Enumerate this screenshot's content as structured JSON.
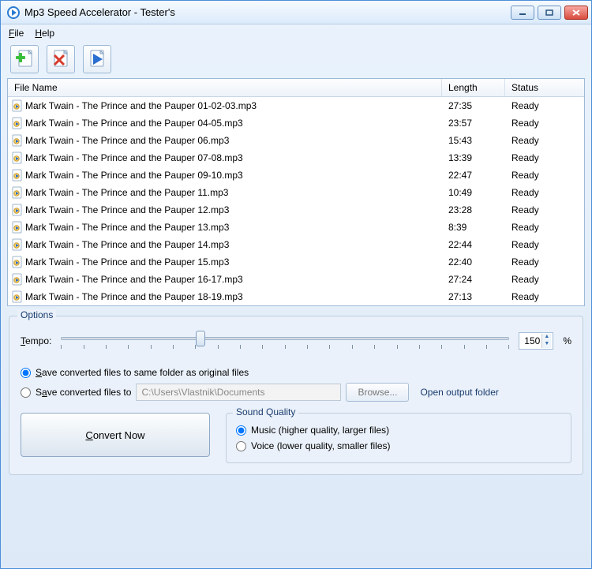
{
  "window": {
    "title": "Mp3 Speed Accelerator - Tester's"
  },
  "menu": {
    "file": "File",
    "help": "Help"
  },
  "columns": {
    "name": "File Name",
    "length": "Length",
    "status": "Status"
  },
  "files": [
    {
      "name": "Mark Twain - The Prince and the Pauper 01-02-03.mp3",
      "length": "27:35",
      "status": "Ready"
    },
    {
      "name": "Mark Twain - The Prince and the Pauper 04-05.mp3",
      "length": "23:57",
      "status": "Ready"
    },
    {
      "name": "Mark Twain - The Prince and the Pauper 06.mp3",
      "length": "15:43",
      "status": "Ready"
    },
    {
      "name": "Mark Twain - The Prince and the Pauper 07-08.mp3",
      "length": "13:39",
      "status": "Ready"
    },
    {
      "name": "Mark Twain - The Prince and the Pauper 09-10.mp3",
      "length": "22:47",
      "status": "Ready"
    },
    {
      "name": "Mark Twain - The Prince and the Pauper 11.mp3",
      "length": "10:49",
      "status": "Ready"
    },
    {
      "name": "Mark Twain - The Prince and the Pauper 12.mp3",
      "length": "23:28",
      "status": "Ready"
    },
    {
      "name": "Mark Twain - The Prince and the Pauper 13.mp3",
      "length": "8:39",
      "status": "Ready"
    },
    {
      "name": "Mark Twain - The Prince and the Pauper 14.mp3",
      "length": "22:44",
      "status": "Ready"
    },
    {
      "name": "Mark Twain - The Prince and the Pauper 15.mp3",
      "length": "22:40",
      "status": "Ready"
    },
    {
      "name": "Mark Twain - The Prince and the Pauper 16-17.mp3",
      "length": "27:24",
      "status": "Ready"
    },
    {
      "name": "Mark Twain - The Prince and the Pauper 18-19.mp3",
      "length": "27:13",
      "status": "Ready"
    }
  ],
  "options": {
    "group_label": "Options",
    "tempo_label": "Tempo:",
    "tempo_value": "150",
    "tempo_unit": "%",
    "save_same_label": "Save converted files to same folder as original files",
    "save_to_label": "Save converted files to",
    "save_path": "C:\\Users\\Vlastnik\\Documents",
    "browse_label": "Browse...",
    "open_folder_label": "Open output folder",
    "convert_label": "Convert Now",
    "sound_group_label": "Sound Quality",
    "sound_music_label": "Music (higher quality, larger files)",
    "sound_voice_label": "Voice (lower quality, smaller files)"
  }
}
